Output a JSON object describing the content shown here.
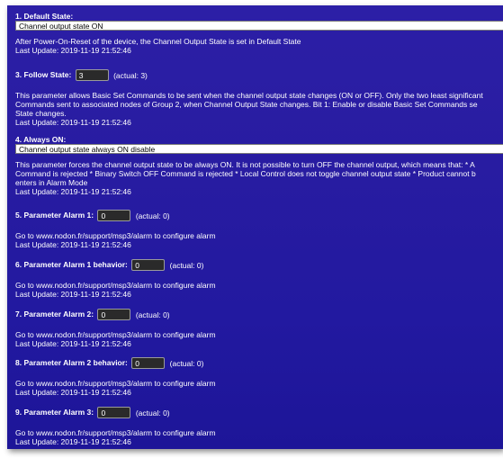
{
  "default_state": {
    "title": "1. Default State:",
    "value": "Channel output state ON",
    "description": "After Power-On-Reset of the device, the Channel Output State is set in Default State",
    "last_update": "Last Update: 2019-11-19 21:52:46"
  },
  "follow_state": {
    "label": "3. Follow State:",
    "value": "3",
    "actual": "(actual: 3)",
    "description_lines": [
      "This parameter allows Basic Set Commands to be sent when the channel output state changes (ON or OFF). Only the two least significant",
      "Commands sent to associated nodes of Group 2, when Channel Output State changes. Bit 1: Enable or disable Basic Set Commands se",
      "State changes."
    ],
    "last_update": "Last Update: 2019-11-19 21:52:46"
  },
  "always_on": {
    "title": "4. Always ON:",
    "value": "Channel output state always ON disable",
    "description_lines": [
      "This parameter forces the channel output state to be always ON. It is not possible to turn OFF the channel output, which means that: * A",
      "Command is rejected * Binary Switch OFF Command is rejected * Local Control does not toggle channel output state * Product cannot b",
      "enters in Alarm Mode"
    ],
    "last_update": "Last Update: 2019-11-19 21:52:46"
  },
  "alarms": [
    {
      "label": "5. Parameter Alarm 1:",
      "value": "0",
      "actual": "(actual: 0)",
      "description": "Go to www.nodon.fr/support/msp3/alarm to configure alarm",
      "last_update": "Last Update: 2019-11-19 21:52:46"
    },
    {
      "label": "6. Parameter Alarm 1 behavior:",
      "value": "0",
      "actual": "(actual: 0)",
      "description": "Go to www.nodon.fr/support/msp3/alarm to configure alarm",
      "last_update": "Last Update: 2019-11-19 21:52:46"
    },
    {
      "label": "7. Parameter Alarm 2:",
      "value": "0",
      "actual": "(actual: 0)",
      "description": "Go to www.nodon.fr/support/msp3/alarm to configure alarm",
      "last_update": "Last Update: 2019-11-19 21:52:46"
    },
    {
      "label": "8. Parameter Alarm 2 behavior:",
      "value": "0",
      "actual": "(actual: 0)",
      "description": "Go to www.nodon.fr/support/msp3/alarm to configure alarm",
      "last_update": "Last Update: 2019-11-19 21:52:46"
    },
    {
      "label": "9. Parameter Alarm 3:",
      "value": "0",
      "actual": "(actual: 0)",
      "description": "Go to www.nodon.fr/support/msp3/alarm to configure alarm",
      "last_update": "Last Update: 2019-11-19 21:52:46"
    }
  ]
}
